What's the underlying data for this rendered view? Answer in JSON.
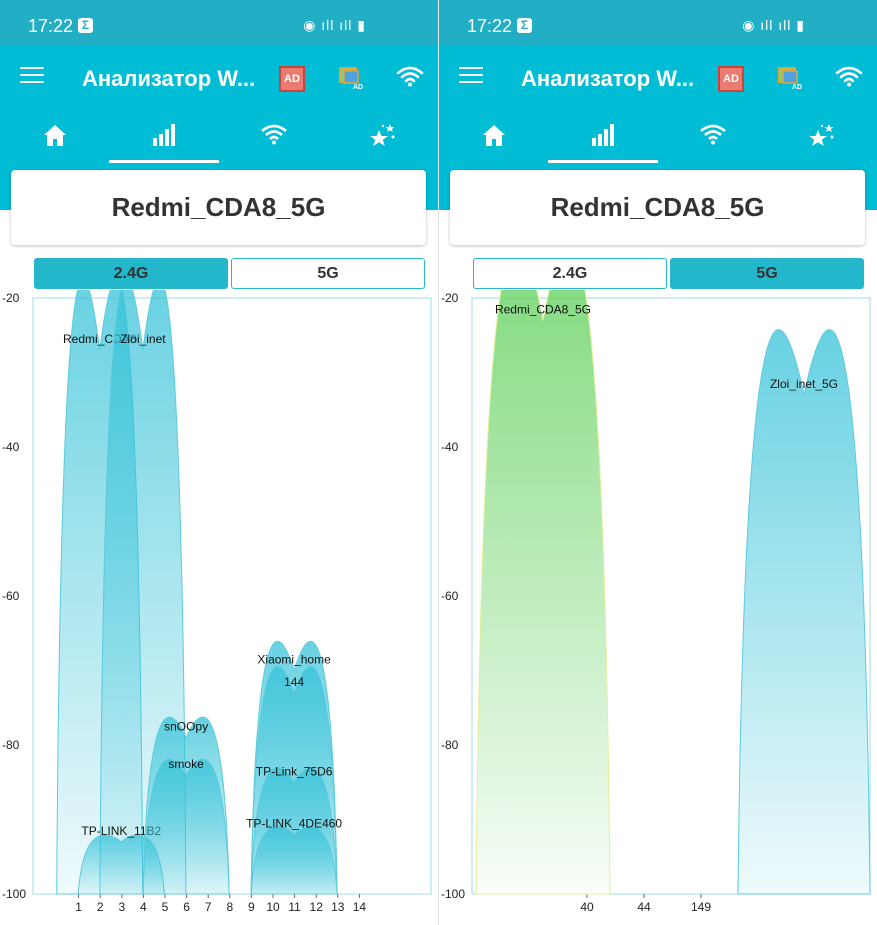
{
  "status": {
    "time": "17:22"
  },
  "app": {
    "title": "Анализатор W...",
    "ad_label": "AD"
  },
  "network": {
    "name": "Redmi_CDA8_5G"
  },
  "bands": {
    "band_24": "2.4G",
    "band_5": "5G"
  },
  "nav": [
    "home-icon",
    "signal-bars-icon",
    "wifi-icon",
    "stars-icon"
  ],
  "colors": {
    "appbar": "#00bcd4",
    "statusbar": "#22aec4",
    "active_network": "#7ed97a",
    "other_network": "#4ec9dd"
  },
  "chart_data": [
    {
      "type": "area",
      "band": "2.4G",
      "ylim": [
        -100,
        -20
      ],
      "yticks": [
        -20,
        -40,
        -60,
        -80,
        -100
      ],
      "xticks": [
        "1",
        "2",
        "3",
        "4",
        "5",
        "6",
        "7",
        "8",
        "9",
        "10",
        "11",
        "12",
        "13",
        "14"
      ],
      "series": [
        {
          "name": "Redmi_CDA8",
          "channel": 2,
          "rssi": -27
        },
        {
          "name": "Zloi_inet",
          "channel": 4,
          "rssi": -27
        },
        {
          "name": "TP-LINK_11B2",
          "channel": 3,
          "rssi": -93
        },
        {
          "name": "snOOpy",
          "channel": 6,
          "rssi": -79
        },
        {
          "name": "smoke",
          "channel": 6,
          "rssi": -84
        },
        {
          "name": "Xiaomi_home",
          "channel": 11,
          "rssi": -70
        },
        {
          "name": "144",
          "channel": 11,
          "rssi": -73
        },
        {
          "name": "TP-Link_75D6",
          "channel": 11,
          "rssi": -85
        },
        {
          "name": "TP-LINK_4DE460",
          "channel": 11,
          "rssi": -92
        }
      ]
    },
    {
      "type": "area",
      "band": "5G",
      "ylim": [
        -100,
        -20
      ],
      "yticks": [
        -20,
        -40,
        -60,
        -80,
        -100
      ],
      "xticks": [
        "40",
        "44",
        "149"
      ],
      "series": [
        {
          "name": "Redmi_CDA8_5G",
          "channel": 40,
          "rssi": -23,
          "active": true
        },
        {
          "name": "Zloi_inet_5G",
          "channel": 149,
          "rssi": -33
        }
      ]
    }
  ]
}
